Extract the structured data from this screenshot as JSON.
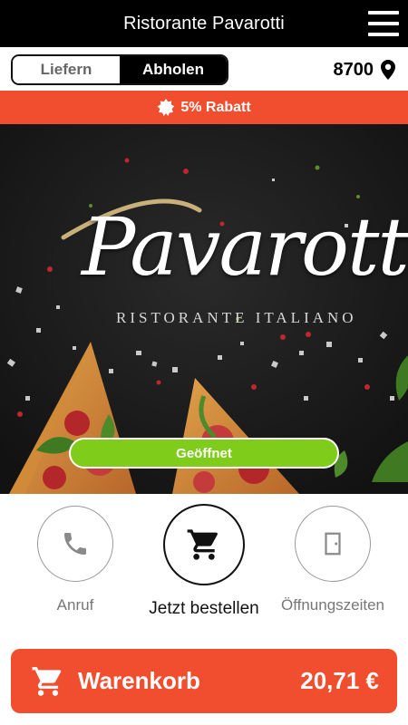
{
  "header": {
    "title": "Ristorante Pavarotti",
    "menu_icon": "hamburger-menu-icon"
  },
  "mode_toggle": {
    "options": [
      "Liefern",
      "Abholen"
    ],
    "selected": "Abholen"
  },
  "location": {
    "zip": "8700",
    "icon": "location-pin-icon"
  },
  "discount": {
    "label": "5% Rabatt",
    "icon": "badge-icon"
  },
  "hero": {
    "logo_script": "Pavarotti",
    "logo_subtitle": "RISTORANTE ITALIANO",
    "status_label": "Geöffnet"
  },
  "actions": [
    {
      "label": "Anruf",
      "icon": "phone-icon"
    },
    {
      "label": "Jetzt bestellen",
      "icon": "cart-icon"
    },
    {
      "label": "Öffnungszeiten",
      "icon": "door-icon"
    }
  ],
  "cart": {
    "label": "Warenkorb",
    "total": "20,71 €",
    "icon": "cart-icon"
  },
  "colors": {
    "accent": "#f04e2f",
    "status_green": "#7fcc1a",
    "header_bg": "#000000"
  }
}
